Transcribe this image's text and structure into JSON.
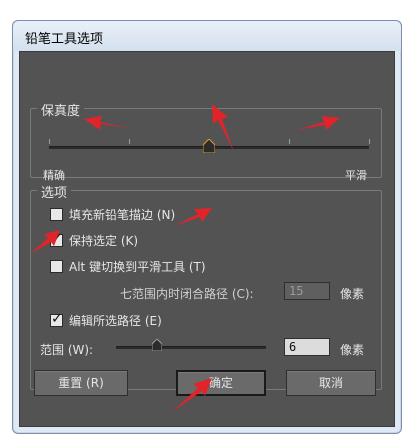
{
  "window": {
    "title": "铅笔工具选项"
  },
  "fidelity": {
    "label": "保真度",
    "left_label": "精确",
    "right_label": "平滑"
  },
  "options": {
    "label": "选项",
    "fill_new": {
      "label": "填充新铅笔描边 (N)",
      "checked": false
    },
    "keep_selected": {
      "label": "保持选定 (K)",
      "checked": true
    },
    "alt_toggle": {
      "label": "Alt 键切换到平滑工具 (T)",
      "checked": false
    },
    "close_paths": {
      "label": "七范围内时闭合路径 (C):",
      "value": "15",
      "unit": "像素"
    },
    "edit_paths": {
      "label": "编辑所选路径 (E)",
      "checked": true
    },
    "range": {
      "label": "范围 (W):",
      "value": "6",
      "unit": "像素"
    }
  },
  "buttons": {
    "reset": "重置 (R)",
    "ok": "确定",
    "cancel": "取消"
  },
  "colors": {
    "panel": "#535353",
    "annotation_red": "#e0242a"
  }
}
